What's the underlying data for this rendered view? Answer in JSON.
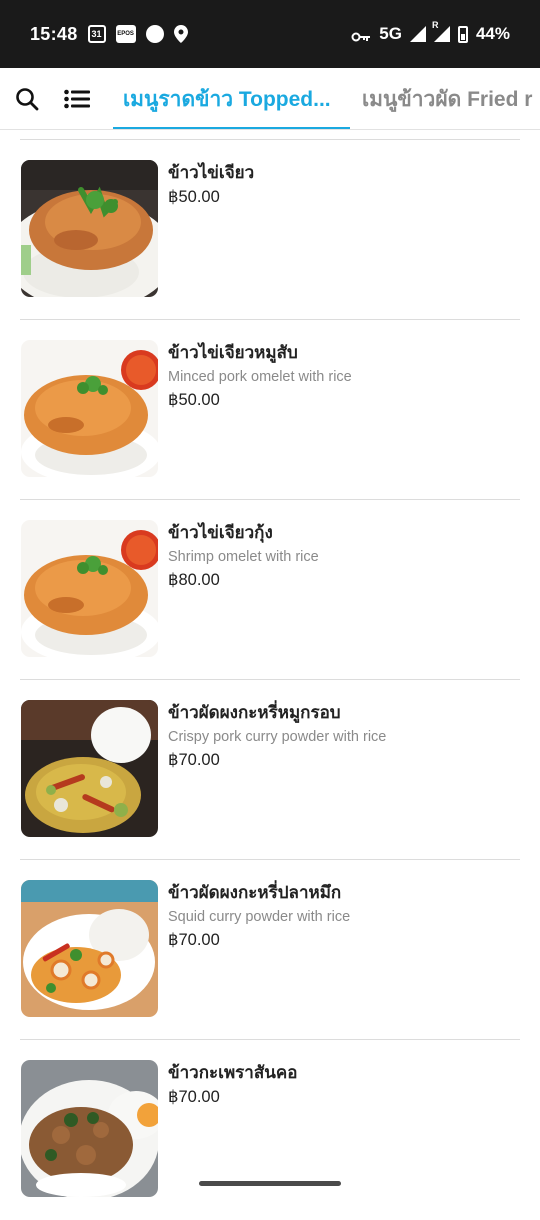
{
  "status_bar": {
    "time": "15:48",
    "calendar_day": "31",
    "app_badge": "EPOS",
    "network": "5G",
    "roaming": "R",
    "battery": "44%"
  },
  "header": {
    "tabs": [
      {
        "label": "เมนูราดข้าว Topped...",
        "active": true
      },
      {
        "label": "เมนูข้าวผัด Fried r",
        "active": false
      }
    ],
    "accent_color": "#1aa9e0"
  },
  "menu_items": [
    {
      "name": "ข้าวไข่เจียว",
      "desc": "",
      "price": "฿50.00",
      "image": "omelet-rice-photo"
    },
    {
      "name": "ข้าวไข่เจียวหมูสับ",
      "desc": "Minced pork omelet with rice",
      "price": "฿50.00",
      "image": "pork-omelet-rice-photo"
    },
    {
      "name": "ข้าวไข่เจียวกุ้ง",
      "desc": "Shrimp omelet with rice",
      "price": "฿80.00",
      "image": "shrimp-omelet-rice-photo"
    },
    {
      "name": "ข้าวผัดผงกะหรี่หมูกรอบ",
      "desc": "Crispy pork curry powder with rice",
      "price": "฿70.00",
      "image": "crispy-pork-curry-photo"
    },
    {
      "name": "ข้าวผัดผงกะหรี่ปลาหมึก",
      "desc": "Squid curry powder with rice",
      "price": "฿70.00",
      "image": "squid-curry-photo"
    },
    {
      "name": "ข้าวกะเพราสันคอ",
      "desc": "",
      "price": "฿70.00",
      "image": "basil-pork-neck-photo"
    }
  ]
}
